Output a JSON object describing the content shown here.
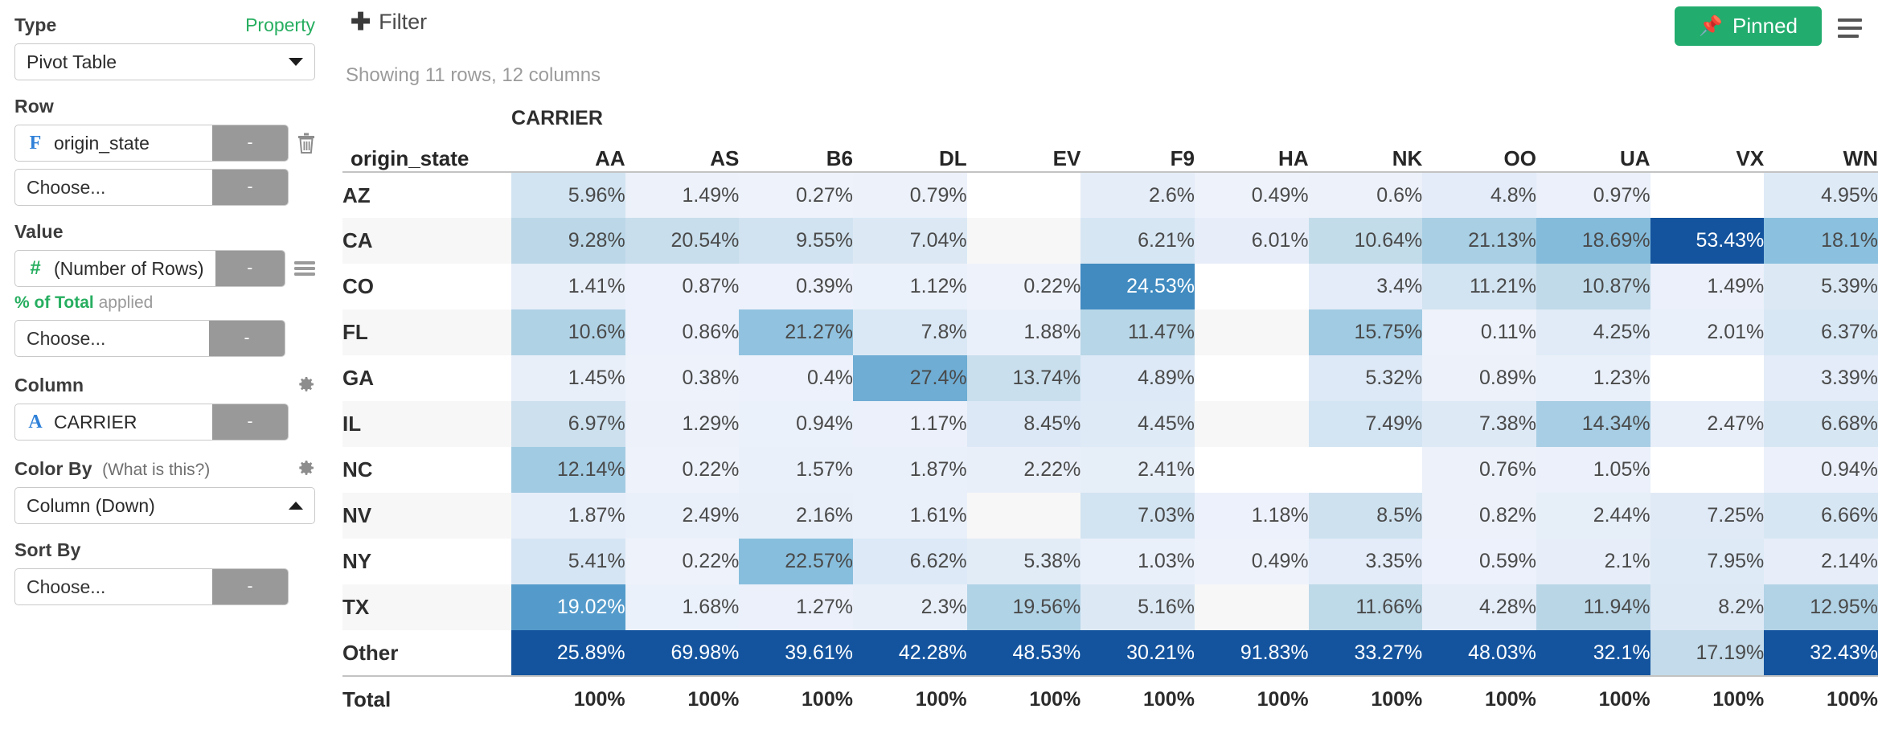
{
  "sidebar": {
    "type_label": "Type",
    "property_label": "Property",
    "type_value": "Pivot Table",
    "row_label": "Row",
    "row_fields": [
      {
        "icon": "F",
        "icon_kind": "field-text-icon",
        "name": "origin_state",
        "tail": "-"
      },
      {
        "icon": "",
        "icon_kind": "none",
        "name": "Choose...",
        "tail": "-"
      }
    ],
    "value_label": "Value",
    "value_fields": [
      {
        "icon": "#",
        "icon_kind": "field-number-icon",
        "name": "(Number of Rows)",
        "tail": "-"
      },
      {
        "icon": "",
        "icon_kind": "none",
        "name": "Choose...",
        "tail": "-"
      }
    ],
    "applied_strong": "% of Total",
    "applied_rest": "applied",
    "column_label": "Column",
    "column_fields": [
      {
        "icon": "A",
        "icon_kind": "field-text-icon",
        "name": "CARRIER",
        "tail": "-"
      }
    ],
    "colorby_label": "Color By",
    "colorby_help": "(What is this?)",
    "colorby_value": "Column (Down)",
    "sortby_label": "Sort By",
    "sortby_value": "Choose...",
    "sortby_tail": "-"
  },
  "topbar": {
    "filter_label": "Filter",
    "pinned_label": "Pinned",
    "showing_text": "Showing 11 rows, 12 columns"
  },
  "colors": {
    "accent_green": "#22ad6e",
    "property_green": "#27ae60",
    "field_blue": "#2f80d8",
    "heat_max": "#14549e",
    "heat_mid": "#3f93c9",
    "heat_low": "#eef2fb"
  },
  "chart_data": {
    "type": "heatmap",
    "title": "",
    "group_header": "CARRIER",
    "row_header": "origin_state",
    "categories": [
      "AA",
      "AS",
      "B6",
      "DL",
      "EV",
      "F9",
      "HA",
      "NK",
      "OO",
      "UA",
      "VX",
      "WN"
    ],
    "rows": [
      {
        "label": "AZ",
        "values": [
          "5.96%",
          "1.49%",
          "0.27%",
          "0.79%",
          "",
          "2.6%",
          "0.49%",
          "0.6%",
          "4.8%",
          "0.97%",
          "",
          "4.95%"
        ],
        "nums": [
          5.96,
          1.49,
          0.27,
          0.79,
          null,
          2.6,
          0.49,
          0.6,
          4.8,
          0.97,
          null,
          4.95
        ]
      },
      {
        "label": "CA",
        "values": [
          "9.28%",
          "20.54%",
          "9.55%",
          "7.04%",
          "",
          "6.21%",
          "6.01%",
          "10.64%",
          "21.13%",
          "18.69%",
          "53.43%",
          "18.1%"
        ],
        "nums": [
          9.28,
          20.54,
          9.55,
          7.04,
          null,
          6.21,
          6.01,
          10.64,
          21.13,
          18.69,
          53.43,
          18.1
        ]
      },
      {
        "label": "CO",
        "values": [
          "1.41%",
          "0.87%",
          "0.39%",
          "1.12%",
          "0.22%",
          "24.53%",
          "",
          "3.4%",
          "11.21%",
          "10.87%",
          "1.49%",
          "5.39%"
        ],
        "nums": [
          1.41,
          0.87,
          0.39,
          1.12,
          0.22,
          24.53,
          null,
          3.4,
          11.21,
          10.87,
          1.49,
          5.39
        ]
      },
      {
        "label": "FL",
        "values": [
          "10.6%",
          "0.86%",
          "21.27%",
          "7.8%",
          "1.88%",
          "11.47%",
          "",
          "15.75%",
          "0.11%",
          "4.25%",
          "2.01%",
          "6.37%"
        ],
        "nums": [
          10.6,
          0.86,
          21.27,
          7.8,
          1.88,
          11.47,
          null,
          15.75,
          0.11,
          4.25,
          2.01,
          6.37
        ]
      },
      {
        "label": "GA",
        "values": [
          "1.45%",
          "0.38%",
          "0.4%",
          "27.4%",
          "13.74%",
          "4.89%",
          "",
          "5.32%",
          "0.89%",
          "1.23%",
          "",
          "3.39%"
        ],
        "nums": [
          1.45,
          0.38,
          0.4,
          27.4,
          13.74,
          4.89,
          null,
          5.32,
          0.89,
          1.23,
          null,
          3.39
        ]
      },
      {
        "label": "IL",
        "values": [
          "6.97%",
          "1.29%",
          "0.94%",
          "1.17%",
          "8.45%",
          "4.45%",
          "",
          "7.49%",
          "7.38%",
          "14.34%",
          "2.47%",
          "6.68%"
        ],
        "nums": [
          6.97,
          1.29,
          0.94,
          1.17,
          8.45,
          4.45,
          null,
          7.49,
          7.38,
          14.34,
          2.47,
          6.68
        ]
      },
      {
        "label": "NC",
        "values": [
          "12.14%",
          "0.22%",
          "1.57%",
          "1.87%",
          "2.22%",
          "2.41%",
          "",
          "",
          "0.76%",
          "1.05%",
          "",
          "0.94%"
        ],
        "nums": [
          12.14,
          0.22,
          1.57,
          1.87,
          2.22,
          2.41,
          null,
          null,
          0.76,
          1.05,
          null,
          0.94
        ]
      },
      {
        "label": "NV",
        "values": [
          "1.87%",
          "2.49%",
          "2.16%",
          "1.61%",
          "",
          "7.03%",
          "1.18%",
          "8.5%",
          "0.82%",
          "2.44%",
          "7.25%",
          "6.66%"
        ],
        "nums": [
          1.87,
          2.49,
          2.16,
          1.61,
          null,
          7.03,
          1.18,
          8.5,
          0.82,
          2.44,
          7.25,
          6.66
        ]
      },
      {
        "label": "NY",
        "values": [
          "5.41%",
          "0.22%",
          "22.57%",
          "6.62%",
          "5.38%",
          "1.03%",
          "0.49%",
          "3.35%",
          "0.59%",
          "2.1%",
          "7.95%",
          "2.14%"
        ],
        "nums": [
          5.41,
          0.22,
          22.57,
          6.62,
          5.38,
          1.03,
          0.49,
          3.35,
          0.59,
          2.1,
          7.95,
          2.14
        ]
      },
      {
        "label": "TX",
        "values": [
          "19.02%",
          "1.68%",
          "1.27%",
          "2.3%",
          "19.56%",
          "5.16%",
          "",
          "11.66%",
          "4.28%",
          "11.94%",
          "8.2%",
          "12.95%"
        ],
        "nums": [
          19.02,
          1.68,
          1.27,
          2.3,
          19.56,
          5.16,
          null,
          11.66,
          4.28,
          11.94,
          8.2,
          12.95
        ]
      },
      {
        "label": "Other",
        "values": [
          "25.89%",
          "69.98%",
          "39.61%",
          "42.28%",
          "48.53%",
          "30.21%",
          "91.83%",
          "33.27%",
          "48.03%",
          "32.1%",
          "17.19%",
          "32.43%"
        ],
        "nums": [
          25.89,
          69.98,
          39.61,
          42.28,
          48.53,
          30.21,
          91.83,
          33.27,
          48.03,
          32.1,
          17.19,
          32.43
        ]
      }
    ],
    "total_row": {
      "label": "Total",
      "values": [
        "100%",
        "100%",
        "100%",
        "100%",
        "100%",
        "100%",
        "100%",
        "100%",
        "100%",
        "100%",
        "100%",
        "100%"
      ]
    },
    "colorby": "Column (Down)",
    "value_measure": "% of Total of (Number of Rows)"
  }
}
